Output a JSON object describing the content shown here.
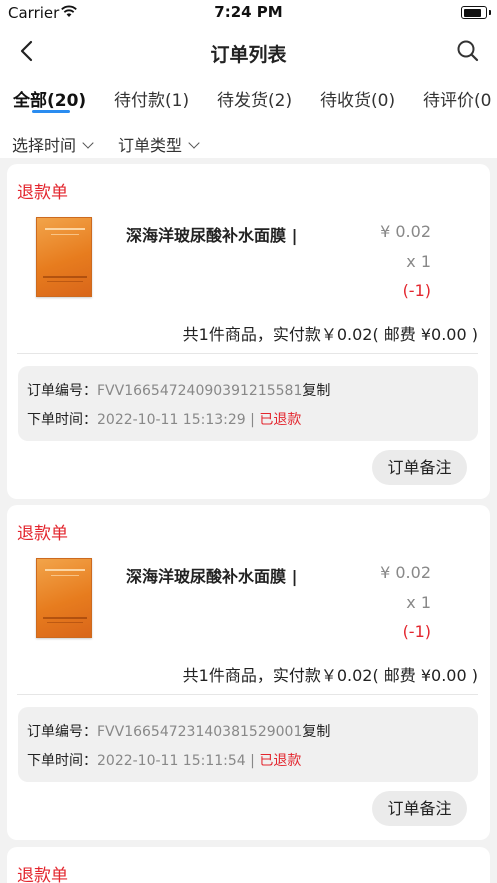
{
  "status_bar": {
    "carrier": "Carrier",
    "time": "7:24 PM"
  },
  "nav": {
    "title": "订单列表",
    "back_icon": "chevron-left-icon",
    "search_icon": "search-icon"
  },
  "tabs": [
    {
      "label": "全部(20)",
      "active": true
    },
    {
      "label": "待付款(1)",
      "active": false
    },
    {
      "label": "待发货(2)",
      "active": false
    },
    {
      "label": "待收货(0)",
      "active": false
    },
    {
      "label": "待评价(0",
      "active": false
    }
  ],
  "filters": {
    "time_label": "选择时间",
    "type_label": "订单类型"
  },
  "labels": {
    "order_no": "订单编号：",
    "order_time": "下单时间：",
    "copy": "复制",
    "separator": " | ",
    "remark_button": "订单备注"
  },
  "orders": [
    {
      "tag": "退款单",
      "product_name": "深海洋玻尿酸补水面膜 |",
      "price": "¥ 0.02",
      "qty": "x 1",
      "refund_qty": "(-1)",
      "summary": "共1件商品，实付款￥0.02( 邮费 ¥0.00 )",
      "order_no": "FVV16654724090391215581",
      "order_time": "2022-10-11 15:13:29",
      "status": "已退款"
    },
    {
      "tag": "退款单",
      "product_name": "深海洋玻尿酸补水面膜 |",
      "price": "¥ 0.02",
      "qty": "x 1",
      "refund_qty": "(-1)",
      "summary": "共1件商品，实付款￥0.02( 邮费 ¥0.00 )",
      "order_no": "FVV16654723140381529001",
      "order_time": "2022-10-11 15:11:54",
      "status": "已退款"
    },
    {
      "tag": "退款单"
    }
  ],
  "colors": {
    "accent": "#2a8cf0",
    "refund_red": "#e3262e",
    "background": "#f2f2f2"
  }
}
